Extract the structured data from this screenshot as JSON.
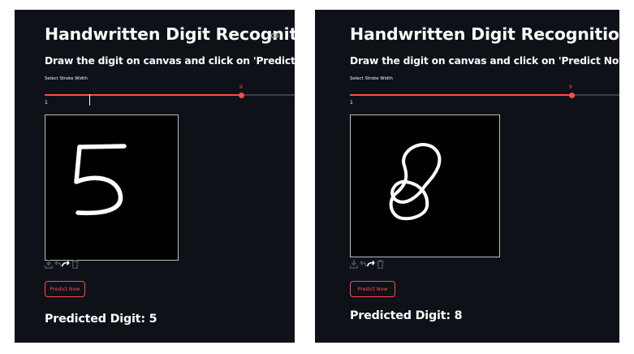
{
  "screens": [
    {
      "title": "Handwritten Digit Recognition",
      "subtitle": "Draw the digit on canvas and click on 'Predict Now'",
      "slider": {
        "label": "Select Stroke Width",
        "value": "9",
        "min_label": "1",
        "fraction": 0.73
      },
      "canvas_drawing": "digit 5",
      "toolbar_icons": [
        "download-icon",
        "undo-icon",
        "redo-icon",
        "trash-icon"
      ],
      "button_label": "Predict Now",
      "result": "Predicted Digit: 5"
    },
    {
      "title": "Handwritten Digit Recognition",
      "subtitle": "Draw the digit on canvas and click on 'Predict Now'",
      "slider": {
        "label": "Select Stroke Width",
        "value": "9",
        "min_label": "1",
        "fraction": 0.73
      },
      "canvas_drawing": "digit 8",
      "toolbar_icons": [
        "download-icon",
        "undo-icon",
        "redo-icon",
        "trash-icon"
      ],
      "button_label": "Predict Now",
      "result": "Predicted Digit: 8"
    }
  ],
  "colors": {
    "background": "#0e1117",
    "text": "#fafafa",
    "accent": "#ff4b4b",
    "track": "#3b3f4a",
    "canvas": "#000000"
  }
}
